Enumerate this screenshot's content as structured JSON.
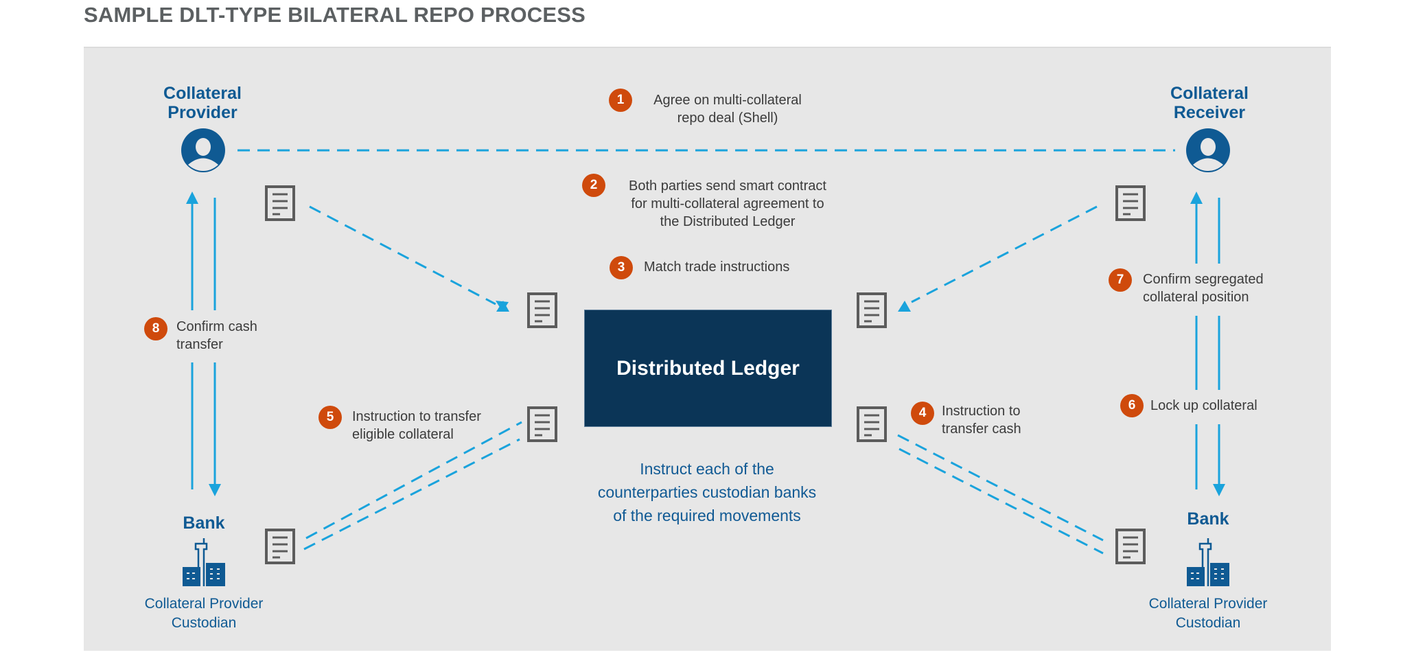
{
  "title": "SAMPLE DLT-TYPE BILATERAL REPO PROCESS",
  "colors": {
    "panel_bg": "#e7e7e7",
    "accent_blue": "#0f5a93",
    "ledger_bg": "#0b3557",
    "arrow_blue": "#1aa3dc",
    "badge_orange": "#cf4a0c",
    "doc_gray": "#5c5c5c",
    "text_dark": "#3b3b3b"
  },
  "parties": {
    "provider": {
      "label_line1": "Collateral",
      "label_line2": "Provider",
      "icon": "person-icon"
    },
    "receiver": {
      "label_line1": "Collateral",
      "label_line2": "Receiver",
      "icon": "person-icon"
    }
  },
  "banks": {
    "left": {
      "title": "Bank",
      "sub_line1": "Collateral Provider",
      "sub_line2": "Custodian",
      "icon": "bank-building-icon"
    },
    "right": {
      "title": "Bank",
      "sub_line1": "Collateral Provider",
      "sub_line2": "Custodian",
      "icon": "bank-building-icon"
    }
  },
  "ledger": {
    "label": "Distributed Ledger"
  },
  "instruction_note": {
    "line1": "Instruct each of the",
    "line2": "counterparties custodian banks",
    "line3": "of the required movements"
  },
  "steps": [
    {
      "number": "1",
      "line1": "Agree on multi-collateral",
      "line2": "repo deal (Shell)"
    },
    {
      "number": "2",
      "line1": "Both parties send smart contract",
      "line2": "for multi-collateral agreement to",
      "line3": "the Distributed Ledger"
    },
    {
      "number": "3",
      "line1": "Match trade instructions"
    },
    {
      "number": "4",
      "line1": "Instruction to",
      "line2": "transfer cash"
    },
    {
      "number": "5",
      "line1": "Instruction to transfer",
      "line2": "eligible collateral"
    },
    {
      "number": "6",
      "line1": "Lock up collateral"
    },
    {
      "number": "7",
      "line1": "Confirm segregated",
      "line2": "collateral position"
    },
    {
      "number": "8",
      "line1": "Confirm cash",
      "line2": "transfer"
    }
  ]
}
